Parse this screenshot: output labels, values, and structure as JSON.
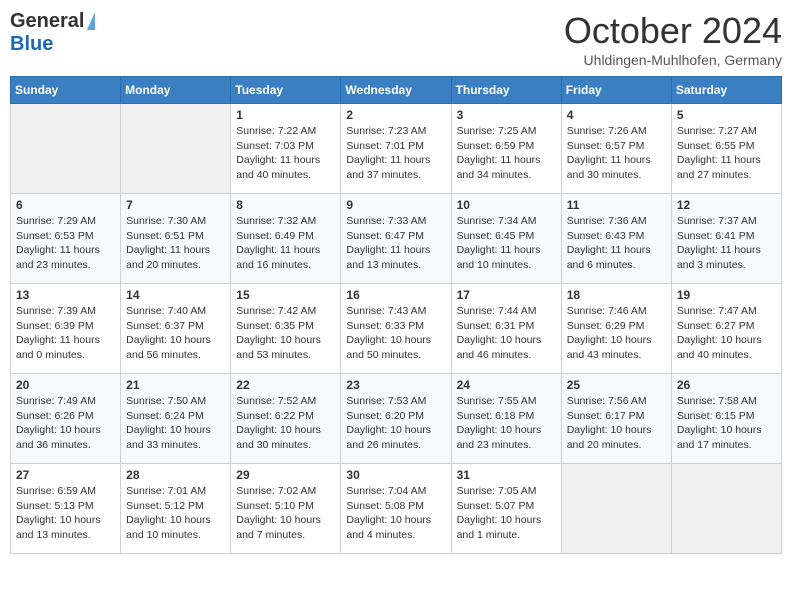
{
  "header": {
    "logo_general": "General",
    "logo_blue": "Blue",
    "month_title": "October 2024",
    "location": "Uhldingen-Muhlhofen, Germany"
  },
  "weekdays": [
    "Sunday",
    "Monday",
    "Tuesday",
    "Wednesday",
    "Thursday",
    "Friday",
    "Saturday"
  ],
  "weeks": [
    [
      {
        "day": "",
        "info": ""
      },
      {
        "day": "",
        "info": ""
      },
      {
        "day": "1",
        "info": "Sunrise: 7:22 AM\nSunset: 7:03 PM\nDaylight: 11 hours\nand 40 minutes."
      },
      {
        "day": "2",
        "info": "Sunrise: 7:23 AM\nSunset: 7:01 PM\nDaylight: 11 hours\nand 37 minutes."
      },
      {
        "day": "3",
        "info": "Sunrise: 7:25 AM\nSunset: 6:59 PM\nDaylight: 11 hours\nand 34 minutes."
      },
      {
        "day": "4",
        "info": "Sunrise: 7:26 AM\nSunset: 6:57 PM\nDaylight: 11 hours\nand 30 minutes."
      },
      {
        "day": "5",
        "info": "Sunrise: 7:27 AM\nSunset: 6:55 PM\nDaylight: 11 hours\nand 27 minutes."
      }
    ],
    [
      {
        "day": "6",
        "info": "Sunrise: 7:29 AM\nSunset: 6:53 PM\nDaylight: 11 hours\nand 23 minutes."
      },
      {
        "day": "7",
        "info": "Sunrise: 7:30 AM\nSunset: 6:51 PM\nDaylight: 11 hours\nand 20 minutes."
      },
      {
        "day": "8",
        "info": "Sunrise: 7:32 AM\nSunset: 6:49 PM\nDaylight: 11 hours\nand 16 minutes."
      },
      {
        "day": "9",
        "info": "Sunrise: 7:33 AM\nSunset: 6:47 PM\nDaylight: 11 hours\nand 13 minutes."
      },
      {
        "day": "10",
        "info": "Sunrise: 7:34 AM\nSunset: 6:45 PM\nDaylight: 11 hours\nand 10 minutes."
      },
      {
        "day": "11",
        "info": "Sunrise: 7:36 AM\nSunset: 6:43 PM\nDaylight: 11 hours\nand 6 minutes."
      },
      {
        "day": "12",
        "info": "Sunrise: 7:37 AM\nSunset: 6:41 PM\nDaylight: 11 hours\nand 3 minutes."
      }
    ],
    [
      {
        "day": "13",
        "info": "Sunrise: 7:39 AM\nSunset: 6:39 PM\nDaylight: 11 hours\nand 0 minutes."
      },
      {
        "day": "14",
        "info": "Sunrise: 7:40 AM\nSunset: 6:37 PM\nDaylight: 10 hours\nand 56 minutes."
      },
      {
        "day": "15",
        "info": "Sunrise: 7:42 AM\nSunset: 6:35 PM\nDaylight: 10 hours\nand 53 minutes."
      },
      {
        "day": "16",
        "info": "Sunrise: 7:43 AM\nSunset: 6:33 PM\nDaylight: 10 hours\nand 50 minutes."
      },
      {
        "day": "17",
        "info": "Sunrise: 7:44 AM\nSunset: 6:31 PM\nDaylight: 10 hours\nand 46 minutes."
      },
      {
        "day": "18",
        "info": "Sunrise: 7:46 AM\nSunset: 6:29 PM\nDaylight: 10 hours\nand 43 minutes."
      },
      {
        "day": "19",
        "info": "Sunrise: 7:47 AM\nSunset: 6:27 PM\nDaylight: 10 hours\nand 40 minutes."
      }
    ],
    [
      {
        "day": "20",
        "info": "Sunrise: 7:49 AM\nSunset: 6:26 PM\nDaylight: 10 hours\nand 36 minutes."
      },
      {
        "day": "21",
        "info": "Sunrise: 7:50 AM\nSunset: 6:24 PM\nDaylight: 10 hours\nand 33 minutes."
      },
      {
        "day": "22",
        "info": "Sunrise: 7:52 AM\nSunset: 6:22 PM\nDaylight: 10 hours\nand 30 minutes."
      },
      {
        "day": "23",
        "info": "Sunrise: 7:53 AM\nSunset: 6:20 PM\nDaylight: 10 hours\nand 26 minutes."
      },
      {
        "day": "24",
        "info": "Sunrise: 7:55 AM\nSunset: 6:18 PM\nDaylight: 10 hours\nand 23 minutes."
      },
      {
        "day": "25",
        "info": "Sunrise: 7:56 AM\nSunset: 6:17 PM\nDaylight: 10 hours\nand 20 minutes."
      },
      {
        "day": "26",
        "info": "Sunrise: 7:58 AM\nSunset: 6:15 PM\nDaylight: 10 hours\nand 17 minutes."
      }
    ],
    [
      {
        "day": "27",
        "info": "Sunrise: 6:59 AM\nSunset: 5:13 PM\nDaylight: 10 hours\nand 13 minutes."
      },
      {
        "day": "28",
        "info": "Sunrise: 7:01 AM\nSunset: 5:12 PM\nDaylight: 10 hours\nand 10 minutes."
      },
      {
        "day": "29",
        "info": "Sunrise: 7:02 AM\nSunset: 5:10 PM\nDaylight: 10 hours\nand 7 minutes."
      },
      {
        "day": "30",
        "info": "Sunrise: 7:04 AM\nSunset: 5:08 PM\nDaylight: 10 hours\nand 4 minutes."
      },
      {
        "day": "31",
        "info": "Sunrise: 7:05 AM\nSunset: 5:07 PM\nDaylight: 10 hours\nand 1 minute."
      },
      {
        "day": "",
        "info": ""
      },
      {
        "day": "",
        "info": ""
      }
    ]
  ]
}
